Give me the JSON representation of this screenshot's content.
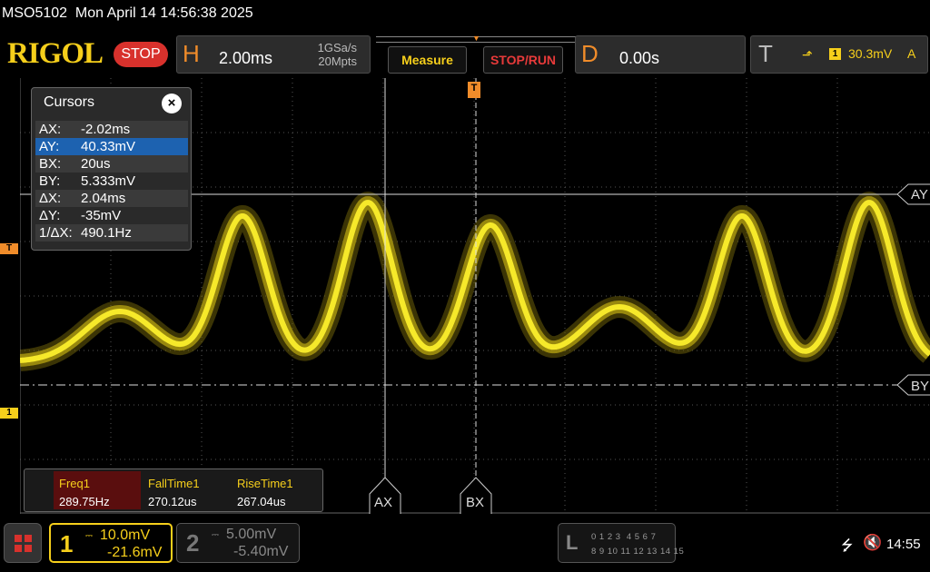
{
  "status_line": "MSO5102  Mon April 14 14:56:38 2025",
  "header": {
    "logo": "RIGOL",
    "run_state": "STOP",
    "horizontal": {
      "letter": "H",
      "timebase": "2.00ms",
      "sample_rate": "1GSa/s",
      "memory_depth": "20Mpts"
    },
    "measure_label": "Measure",
    "stoprun_label": "STOP/RUN",
    "delay": {
      "letter": "D",
      "value": "0.00s"
    },
    "trigger": {
      "letter": "T",
      "channel": "1",
      "level": "30.3mV",
      "mode": "A",
      "edge_icon": "rising-edge-icon"
    }
  },
  "markers": {
    "trigger_level": "T",
    "channel1": "1",
    "trigger_position": "T"
  },
  "cursor_labels": {
    "ax": "AX",
    "bx": "BX",
    "ay": "AY",
    "by": "BY"
  },
  "cursors_panel": {
    "title": "Cursors",
    "close": "×",
    "rows": [
      {
        "key": "AX:",
        "value": "-2.02ms"
      },
      {
        "key": "AY:",
        "value": "40.33mV"
      },
      {
        "key": "BX:",
        "value": "20us"
      },
      {
        "key": "BY:",
        "value": "5.333mV"
      },
      {
        "key": "ΔX:",
        "value": "2.04ms"
      },
      {
        "key": "ΔY:",
        "value": "-35mV"
      },
      {
        "key": "1/ΔX:",
        "value": "490.1Hz"
      }
    ],
    "selected_index": 1
  },
  "measurements": [
    {
      "name": "Freq1",
      "value": "289.75Hz"
    },
    {
      "name": "FallTime1",
      "value": "270.12us"
    },
    {
      "name": "RiseTime1",
      "value": "267.04us"
    }
  ],
  "channels": {
    "ch1": {
      "number": "1",
      "coupling": "DC",
      "scale": "10.0mV",
      "offset": "-21.6mV"
    },
    "ch2": {
      "number": "2",
      "coupling": "DC",
      "scale": "5.00mV",
      "offset": "-5.40mV"
    }
  },
  "logic_analyzer": {
    "label": "L",
    "row1": "0 1 2 3  4 5 6 7",
    "row2": "8 9 10 11 12 13 14 15"
  },
  "system": {
    "clock": "14:55",
    "usb_icon": "usb-icon",
    "sound_icon": "mute-icon"
  },
  "colors": {
    "ch1": "#f6cf1b",
    "trigger": "#f08c2a",
    "stop": "#d8312c",
    "selected_row": "#1d62b0"
  }
}
